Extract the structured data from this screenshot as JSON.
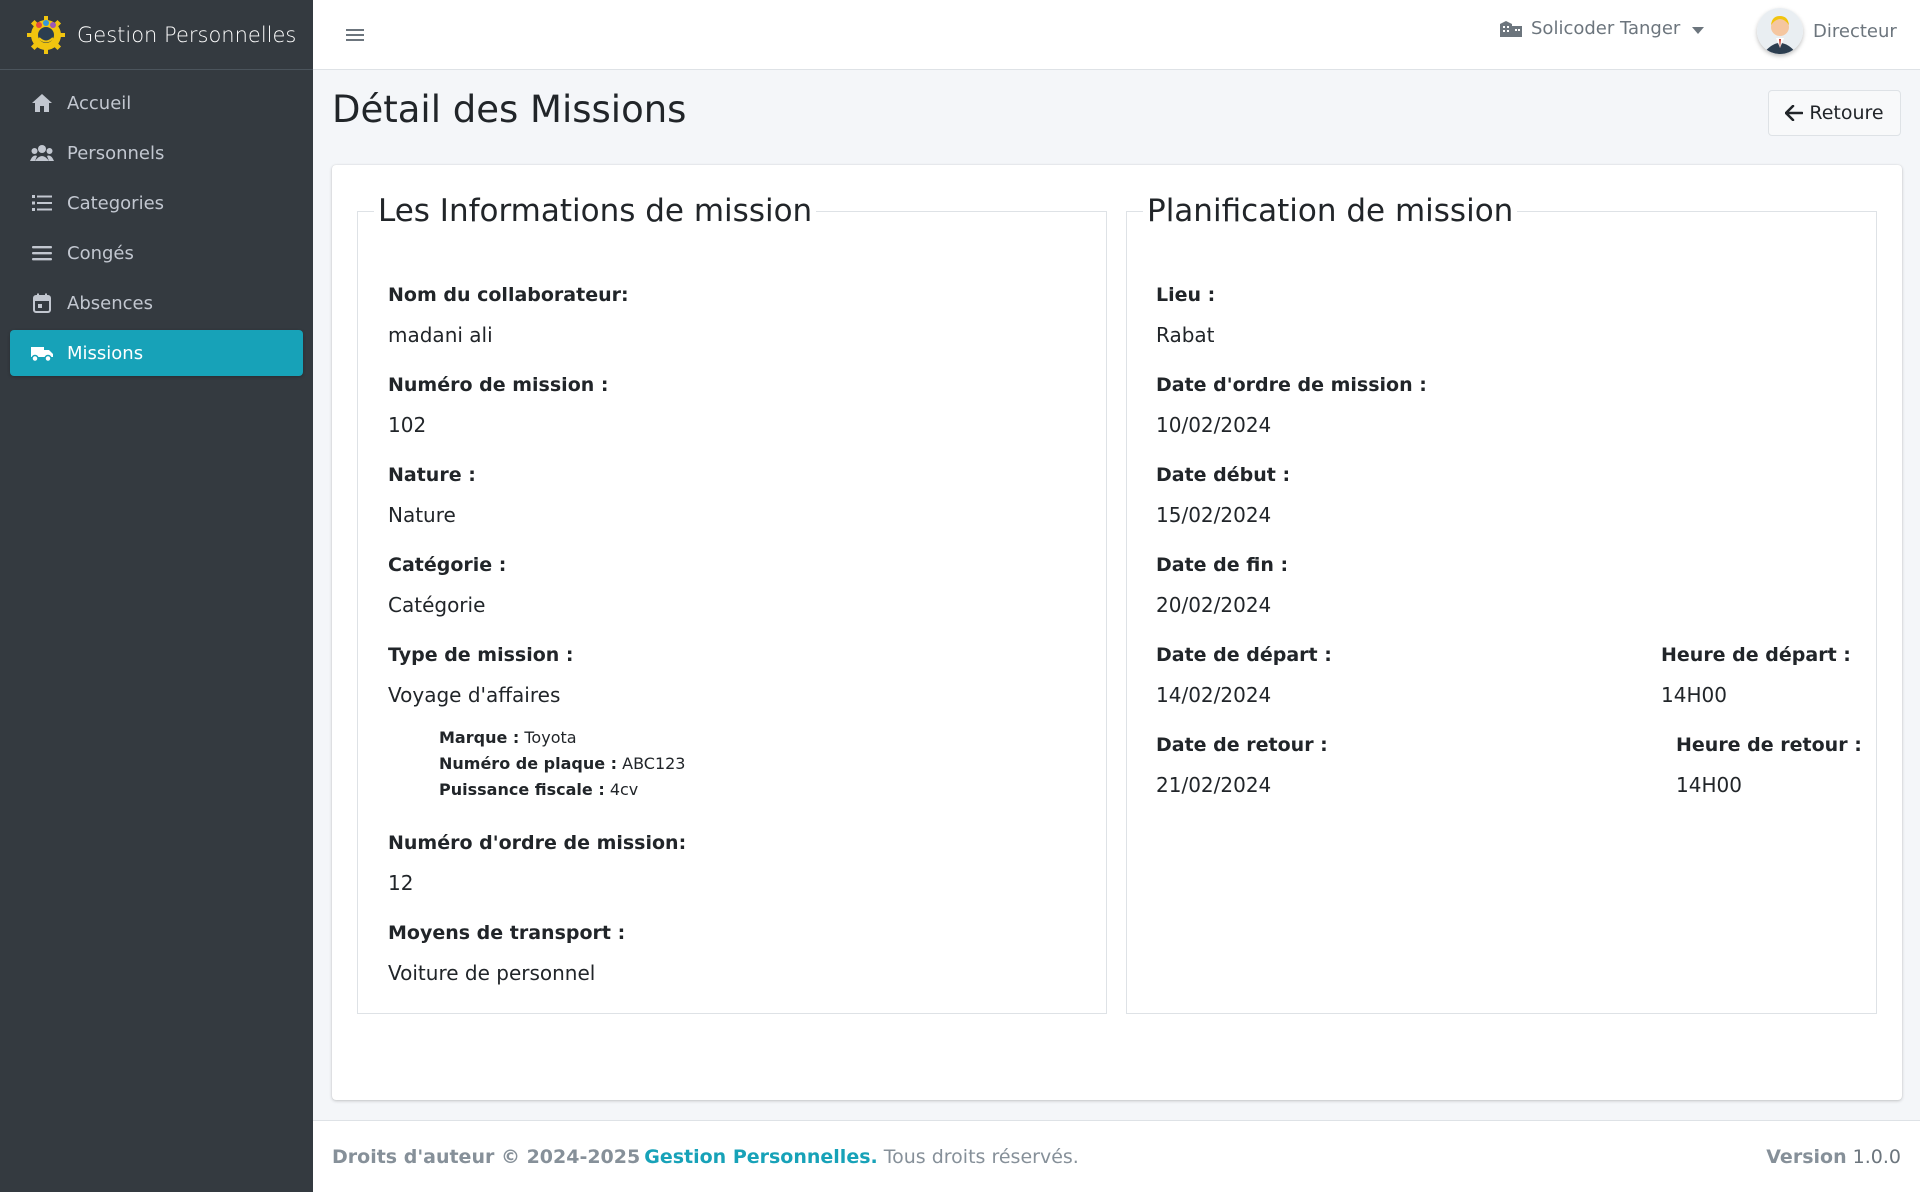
{
  "brand": {
    "name": "Gestion Personnelles"
  },
  "sidebar": {
    "items": [
      {
        "label": "Accueil",
        "icon": "home-icon"
      },
      {
        "label": "Personnels",
        "icon": "users-icon"
      },
      {
        "label": "Categories",
        "icon": "list-icon"
      },
      {
        "label": "Congés",
        "icon": "bars-icon"
      },
      {
        "label": "Absences",
        "icon": "calendar-icon"
      },
      {
        "label": "Missions",
        "icon": "truck-icon",
        "active": true
      }
    ]
  },
  "topbar": {
    "organization": "Solicoder Tanger",
    "user_role": "Directeur"
  },
  "page": {
    "title": "Détail des Missions",
    "back_label": "Retoure"
  },
  "info": {
    "legend": "Les Informations de mission",
    "collaborateur_label": "Nom du collaborateur:",
    "collaborateur_value": "madani ali",
    "numero_label": "Numéro de mission :",
    "numero_value": "102",
    "nature_label": "Nature :",
    "nature_value": "Nature",
    "categorie_label": "Catégorie :",
    "categorie_value": "Catégorie",
    "type_label": "Type de mission :",
    "type_value": "Voyage d'affaires",
    "vehicle": {
      "marque_label": "Marque :",
      "marque_value": "Toyota",
      "plaque_label": "Numéro de plaque :",
      "plaque_value": "ABC123",
      "puissance_label": "Puissance fiscale :",
      "puissance_value": "4cv"
    },
    "ordre_label": "Numéro d'ordre de mission:",
    "ordre_value": "12",
    "transport_label": "Moyens de transport :",
    "transport_value": "Voiture de personnel"
  },
  "planning": {
    "legend": "Planification de mission",
    "lieu_label": "Lieu :",
    "lieu_value": "Rabat",
    "date_ordre_label": "Date d'ordre de mission :",
    "date_ordre_value": "10/02/2024",
    "date_debut_label": "Date début :",
    "date_debut_value": "15/02/2024",
    "date_fin_label": "Date de fin :",
    "date_fin_value": "20/02/2024",
    "date_depart_label": "Date de départ :",
    "date_depart_value": "14/02/2024",
    "heure_depart_label": "Heure de départ :",
    "heure_depart_value": "14H00",
    "date_retour_label": "Date de retour :",
    "date_retour_value": "21/02/2024",
    "heure_retour_label": "Heure de retour :",
    "heure_retour_value": "14H00"
  },
  "footer": {
    "copyright": "Droits d'auteur © 2024-2025",
    "brand_link": "Gestion Personnelles.",
    "rights": "Tous droits réservés.",
    "version_label": "Version",
    "version_value": "1.0.0"
  },
  "colors": {
    "sidebar_bg": "#343a40",
    "accent": "#17a2b8",
    "page_bg": "#f4f6f9"
  }
}
